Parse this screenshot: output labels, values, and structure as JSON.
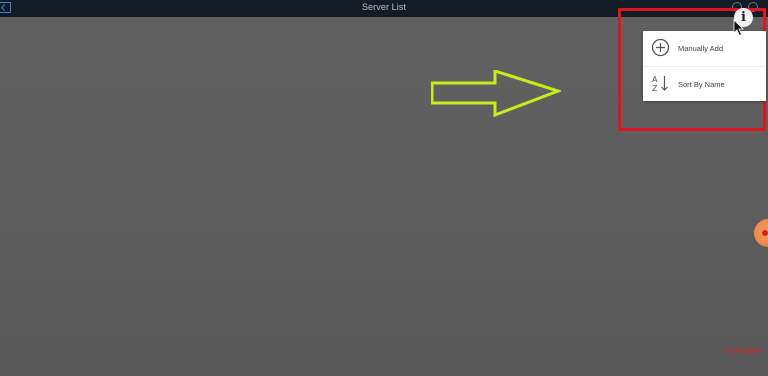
{
  "topbar": {
    "title": "Server List"
  },
  "menu": {
    "items": [
      {
        "label": "Manually Add",
        "icon": "add-circle-icon"
      },
      {
        "label": "Sort By Name",
        "icon": "sort-az-icon"
      }
    ]
  },
  "info_button": {
    "glyph": "i"
  },
  "watermark": {
    "text": "CCTV DESK"
  },
  "colors": {
    "highlight": "#e0141c",
    "arrow": "#c6ee1a",
    "topbar": "#131b26",
    "background": "#5f5f5f"
  }
}
